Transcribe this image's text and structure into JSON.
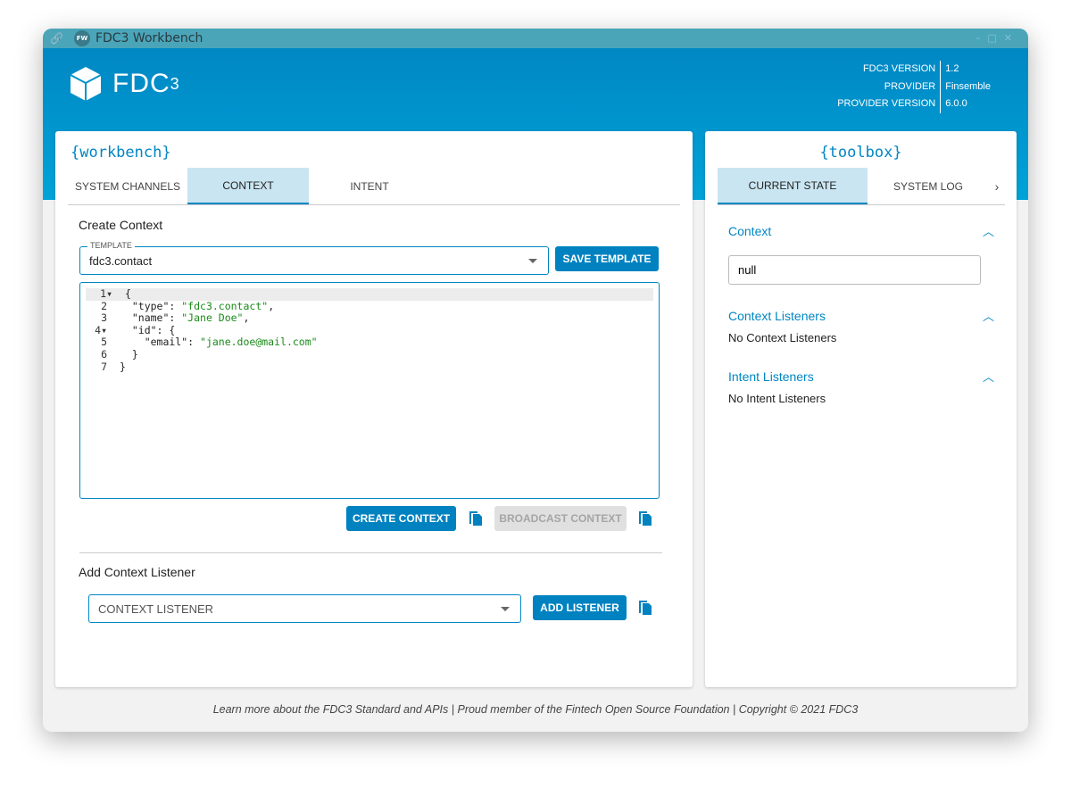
{
  "window": {
    "title": "FDC3 Workbench",
    "badge": "FW"
  },
  "header": {
    "logo": "FDC",
    "logo_sup": "3",
    "info": [
      {
        "key": "FDC3 VERSION",
        "value": "1.2"
      },
      {
        "key": "PROVIDER",
        "value": "Finsemble"
      },
      {
        "key": "PROVIDER VERSION",
        "value": "6.0.0"
      }
    ]
  },
  "workbench": {
    "title": "{workbench}",
    "tabs": [
      "SYSTEM CHANNELS",
      "CONTEXT",
      "INTENT"
    ],
    "active_tab": "CONTEXT",
    "create_context": {
      "heading": "Create Context",
      "template_label": "TEMPLATE",
      "template_value": "fdc3.contact",
      "save_template": "SAVE TEMPLATE",
      "code_lines": [
        [
          "{"
        ],
        [
          "  \"type\": ",
          "\"fdc3.contact\"",
          ","
        ],
        [
          "  \"name\": ",
          "\"Jane Doe\"",
          ","
        ],
        [
          "  \"id\": {"
        ],
        [
          "    \"email\": ",
          "\"jane.doe@mail.com\""
        ],
        [
          "  }"
        ],
        [
          "}"
        ]
      ],
      "create_button": "CREATE CONTEXT",
      "broadcast_button": "BROADCAST CONTEXT"
    },
    "add_listener": {
      "heading": "Add Context Listener",
      "placeholder": "CONTEXT LISTENER",
      "add_button": "ADD LISTENER"
    }
  },
  "toolbox": {
    "title": "{toolbox}",
    "tabs": [
      "CURRENT STATE",
      "SYSTEM LOG"
    ],
    "active_tab": "CURRENT STATE",
    "context": {
      "heading": "Context",
      "value": "null"
    },
    "context_listeners": {
      "heading": "Context Listeners",
      "text": "No Context Listeners"
    },
    "intent_listeners": {
      "heading": "Intent Listeners",
      "text": "No Intent Listeners"
    }
  },
  "footer": "Learn more about the FDC3 Standard and APIs | Proud member of the Fintech Open Source Foundation | Copyright © 2021 FDC3",
  "colors": {
    "primary": "#0082c0",
    "header": "#0087c4",
    "titlebar": "#4aa5b9"
  }
}
